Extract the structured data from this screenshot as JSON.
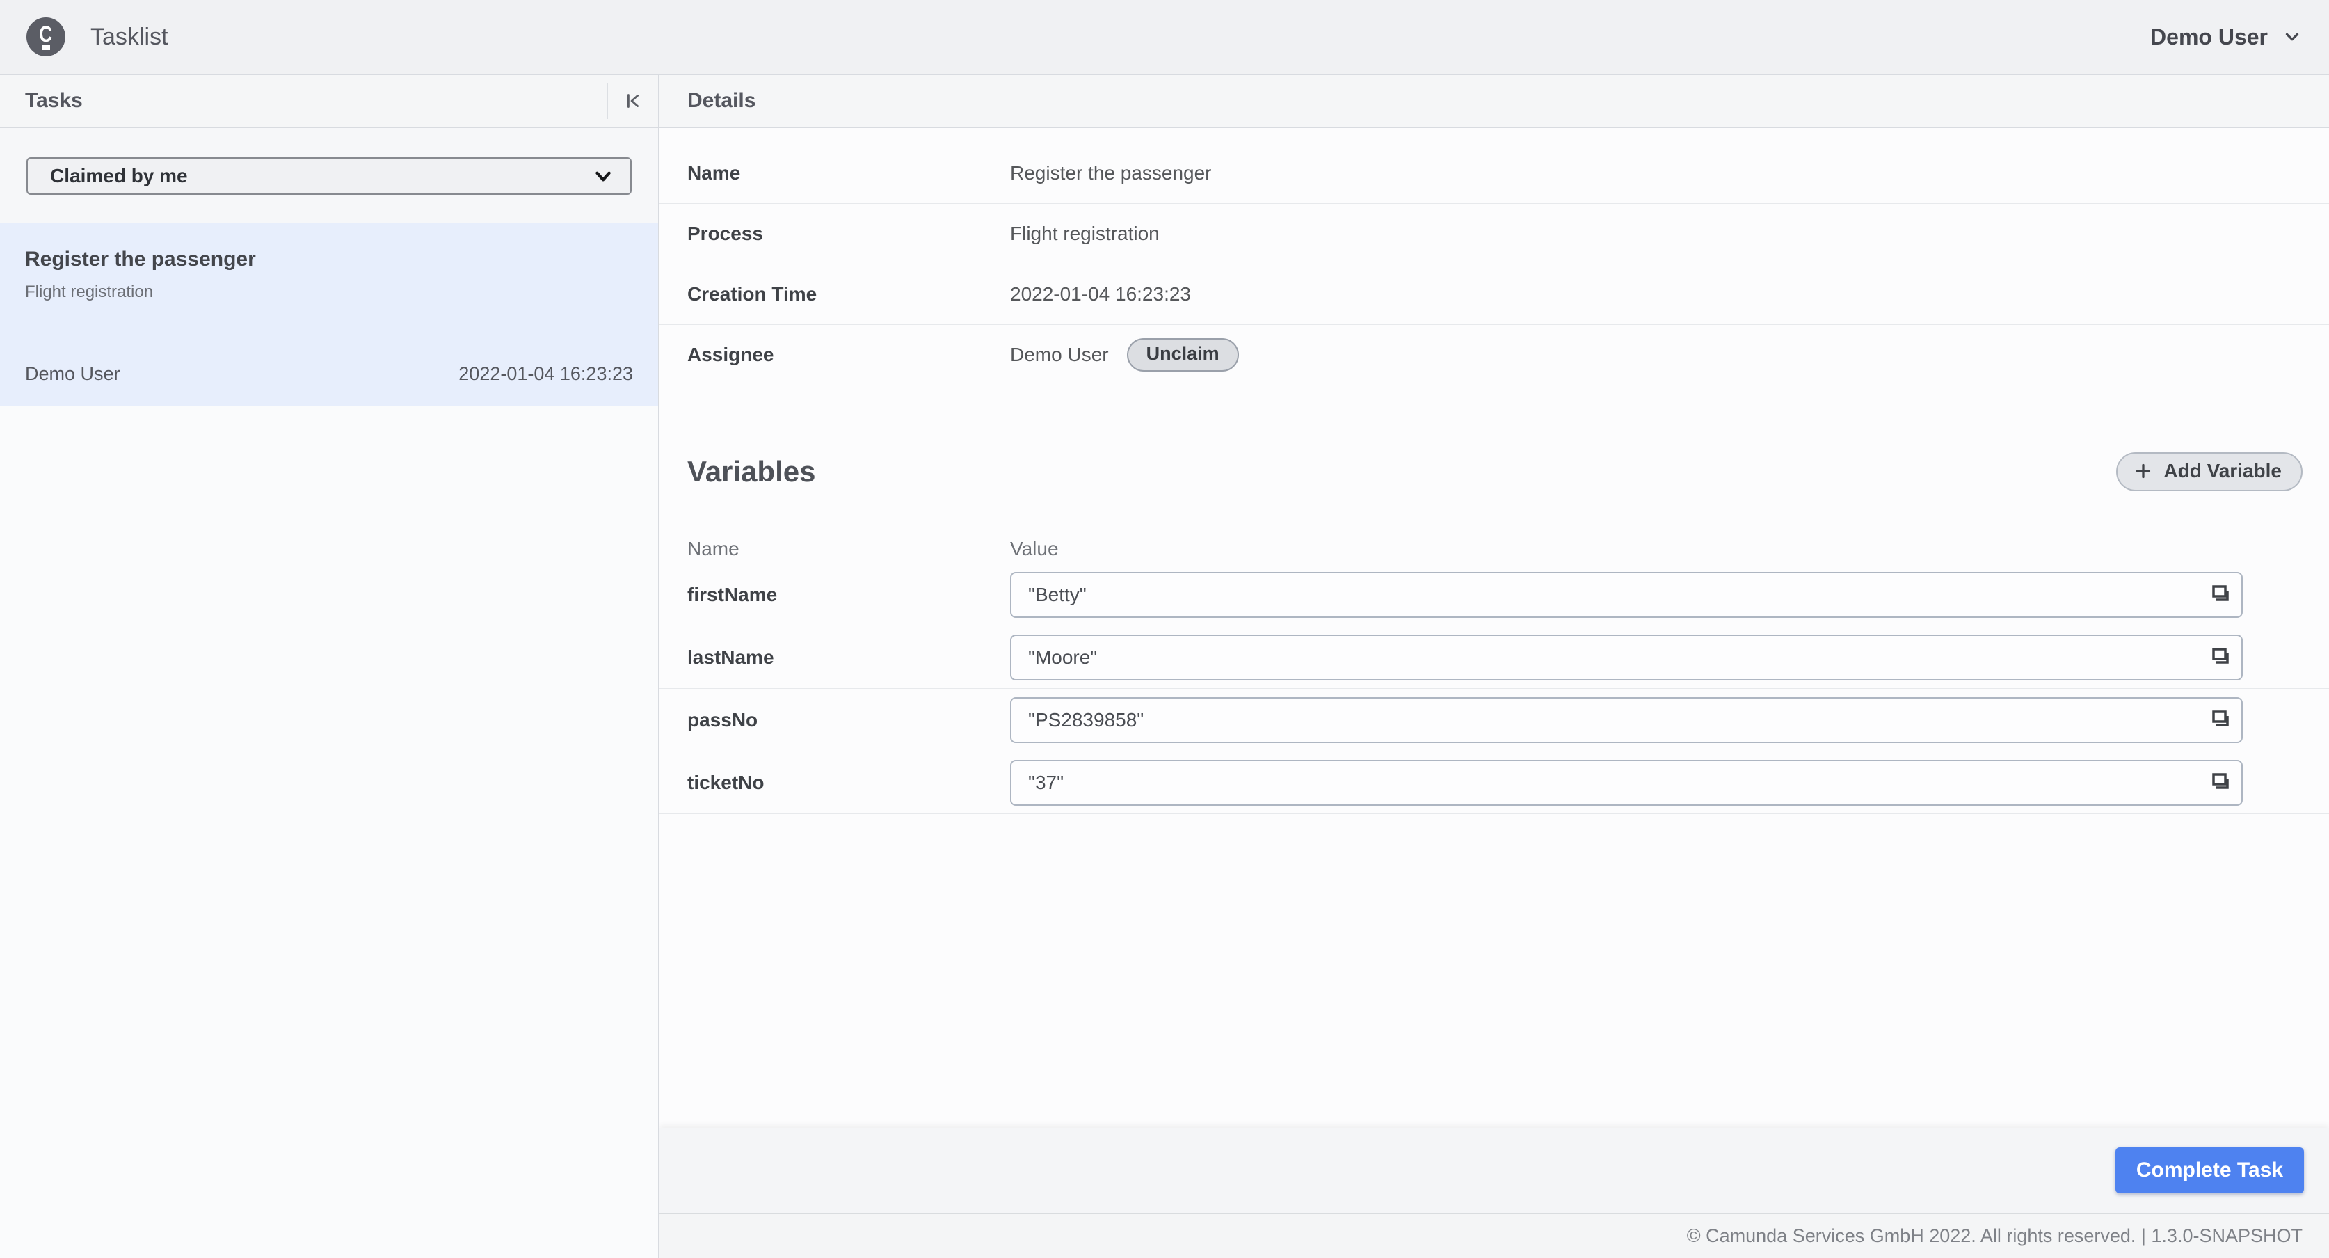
{
  "header": {
    "title": "Tasklist",
    "logo_letter": "C",
    "user": "Demo User"
  },
  "tasks_panel": {
    "title": "Tasks",
    "filter_selected": "Claimed by me",
    "task": {
      "name": "Register the passenger",
      "process": "Flight registration",
      "assignee": "Demo User",
      "creation_time": "2022-01-04 16:23:23",
      "selected": true
    }
  },
  "details": {
    "title": "Details",
    "fields": [
      {
        "label": "Name",
        "value": "Register the passenger"
      },
      {
        "label": "Process",
        "value": "Flight registration"
      },
      {
        "label": "Creation Time",
        "value": "2022-01-04 16:23:23"
      },
      {
        "label": "Assignee",
        "value": "Demo User"
      }
    ],
    "unclaim_label": "Unclaim"
  },
  "variables": {
    "title": "Variables",
    "add_button_label": "Add Variable",
    "columns": {
      "name": "Name",
      "value": "Value"
    },
    "rows": [
      {
        "name": "firstName",
        "value": "\"Betty\""
      },
      {
        "name": "lastName",
        "value": "\"Moore\""
      },
      {
        "name": "passNo",
        "value": "\"PS2839858\""
      },
      {
        "name": "ticketNo",
        "value": "\"37\""
      }
    ]
  },
  "actions": {
    "complete_label": "Complete Task"
  },
  "footer": {
    "copyright": "© Camunda Services GmbH 2022. All rights reserved. | 1.3.0-SNAPSHOT"
  },
  "colors": {
    "accent_blue": "#4e82f0",
    "selected_task_bg": "#e7eefc",
    "header_bg": "#f0f1f3",
    "panel_header_bg": "#f5f6f7",
    "divider": "#d8dbe0",
    "logo_bg": "#5b5d65"
  }
}
